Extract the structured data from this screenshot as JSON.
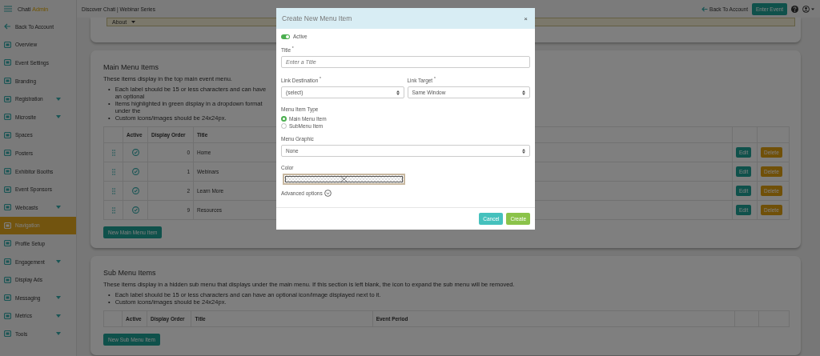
{
  "brand": {
    "name": "Chati",
    "suffix": "Admin"
  },
  "sidebar": {
    "items": [
      {
        "label": "Back To Account",
        "selected": false,
        "has_submenu": false
      },
      {
        "label": "Overview",
        "selected": false,
        "has_submenu": false
      },
      {
        "label": "Event Settings",
        "selected": false,
        "has_submenu": false
      },
      {
        "label": "Branding",
        "selected": false,
        "has_submenu": false
      },
      {
        "label": "Registration",
        "selected": false,
        "has_submenu": true
      },
      {
        "label": "Microsite",
        "selected": false,
        "has_submenu": true
      },
      {
        "label": "Spaces",
        "selected": false,
        "has_submenu": false
      },
      {
        "label": "Posters",
        "selected": false,
        "has_submenu": false
      },
      {
        "label": "Exhibitor Booths",
        "selected": false,
        "has_submenu": false
      },
      {
        "label": "Event Sponsors",
        "selected": false,
        "has_submenu": false
      },
      {
        "label": "Webcasts",
        "selected": false,
        "has_submenu": true
      },
      {
        "label": "Navigation",
        "selected": true,
        "has_submenu": false
      },
      {
        "label": "Profile Setup",
        "selected": false,
        "has_submenu": false
      },
      {
        "label": "Engagement",
        "selected": false,
        "has_submenu": true
      },
      {
        "label": "Display Ads",
        "selected": false,
        "has_submenu": false
      },
      {
        "label": "Messaging",
        "selected": false,
        "has_submenu": true
      },
      {
        "label": "Metrics",
        "selected": false,
        "has_submenu": true
      },
      {
        "label": "Tools",
        "selected": false,
        "has_submenu": true
      }
    ]
  },
  "topbar": {
    "event_title": "Discover Chati | Webinar Series",
    "back_link": "Back To Account",
    "enter_button": "Enter Event"
  },
  "top_card": {
    "select_value": "About"
  },
  "main_menu": {
    "title": "Main Menu Items",
    "description": "These items display in the top main event menu.",
    "bullet_marker": "•",
    "bullets": [
      "Each label should be 15 or less characters and can have an optional",
      "Items highlighted in green display in a dropdown format under the",
      "Custom icons/images should be 24x24px."
    ],
    "columns": [
      "Active",
      "Display Order",
      "Title"
    ],
    "rows": [
      {
        "active": true,
        "order": "0",
        "title": "Home",
        "edit": "Edit",
        "delete": "Delete"
      },
      {
        "active": true,
        "order": "1",
        "title": "Webinars",
        "edit": "Edit",
        "delete": "Delete"
      },
      {
        "active": true,
        "order": "2",
        "title": "Learn More",
        "edit": "Edit",
        "delete": "Delete"
      },
      {
        "active": true,
        "order": "9",
        "title": "Resources",
        "edit": "Edit",
        "delete": "Delete"
      }
    ],
    "new_button": "New Main Menu Item"
  },
  "sub_menu": {
    "title": "Sub Menu Items",
    "description": "These items display in a hidden sub menu that displays under the main menu. If this section is left blank, the icon to expand the sub menu will be removed.",
    "bullet_marker": "•",
    "bullets": [
      "Each label should be 15 or less characters and can have an optional icon/image displayed next to it.",
      "Custom icons/images should be 24x24px."
    ],
    "columns": [
      "Active",
      "Display Order",
      "Title",
      "Event Period"
    ],
    "new_button": "New Sub Menu Item"
  },
  "modal": {
    "title": "Create New Menu Item",
    "close": "×",
    "active": true,
    "active_label": "Active",
    "title_label": "Title $^{*}$",
    "title_placeholder": "Enter a Title",
    "link_destination_label": "Link Destination $^{*}$",
    "link_destination_value": "(select)",
    "link_target_label": "Link Target $^{*}$",
    "link_target_value": "Same Window",
    "item_type_label": "Menu Item Type",
    "item_type": [
      {
        "label": "Main Menu Item",
        "selected": true
      },
      {
        "label": "SubMenu Item",
        "selected": false
      }
    ],
    "graphic_label": "Menu Graphic",
    "graphic_value": "None",
    "color_label": "Color",
    "advanced": "Advanced options",
    "cancel": "Cancel",
    "create": "Create"
  }
}
